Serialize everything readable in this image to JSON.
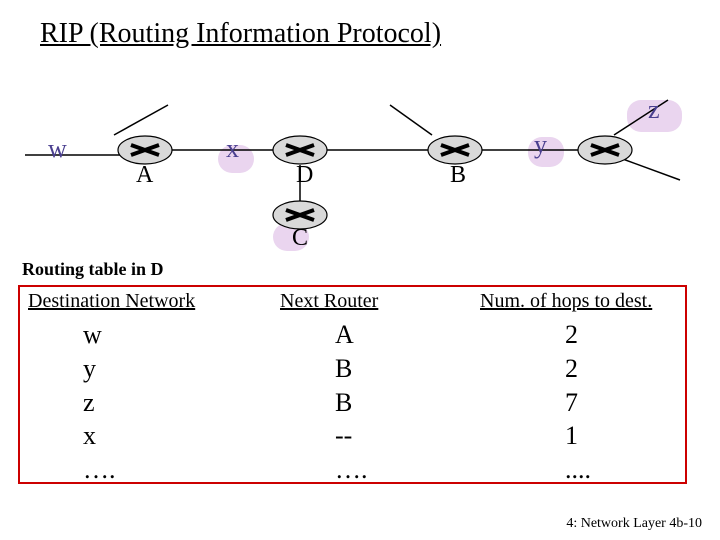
{
  "title": "RIP (Routing Information Protocol)",
  "nets": {
    "w": "w",
    "x": "x",
    "y": "y",
    "z": "z"
  },
  "routers": {
    "A": "A",
    "B": "B",
    "C": "C",
    "D": "D"
  },
  "table_caption": "Routing table in D",
  "table": {
    "headers": {
      "dest": "Destination Network",
      "next": "Next  Router",
      "hops": "Num. of hops to dest."
    },
    "rows": [
      {
        "dest": "w",
        "next": "A",
        "hops": "2"
      },
      {
        "dest": "y",
        "next": "B",
        "hops": "2"
      },
      {
        "dest": "z",
        "next": "B",
        "hops": "7"
      },
      {
        "dest": "x",
        "next": "--",
        "hops": "1"
      },
      {
        "dest": "….",
        "next": "….",
        "hops": "...."
      }
    ]
  },
  "footer": "4: Network Layer   4b-10",
  "chart_data": {
    "type": "diagram",
    "nodes": [
      {
        "id": "A",
        "kind": "router"
      },
      {
        "id": "D",
        "kind": "router"
      },
      {
        "id": "B",
        "kind": "router"
      },
      {
        "id": "C",
        "kind": "router"
      },
      {
        "id": "R_y",
        "kind": "router"
      }
    ],
    "networks": [
      "w",
      "x",
      "y",
      "z"
    ],
    "edges": [
      [
        "w",
        "A"
      ],
      [
        "A",
        "x"
      ],
      [
        "x",
        "D"
      ],
      [
        "D",
        "B"
      ],
      [
        "B",
        "y"
      ],
      [
        "y",
        "R_y"
      ],
      [
        "R_y",
        "z"
      ],
      [
        "D",
        "C"
      ]
    ],
    "routing_table_D": [
      {
        "dest": "w",
        "next": "A",
        "hops": 2
      },
      {
        "dest": "y",
        "next": "B",
        "hops": 2
      },
      {
        "dest": "z",
        "next": "B",
        "hops": 7
      },
      {
        "dest": "x",
        "next": "--",
        "hops": 1
      }
    ]
  }
}
